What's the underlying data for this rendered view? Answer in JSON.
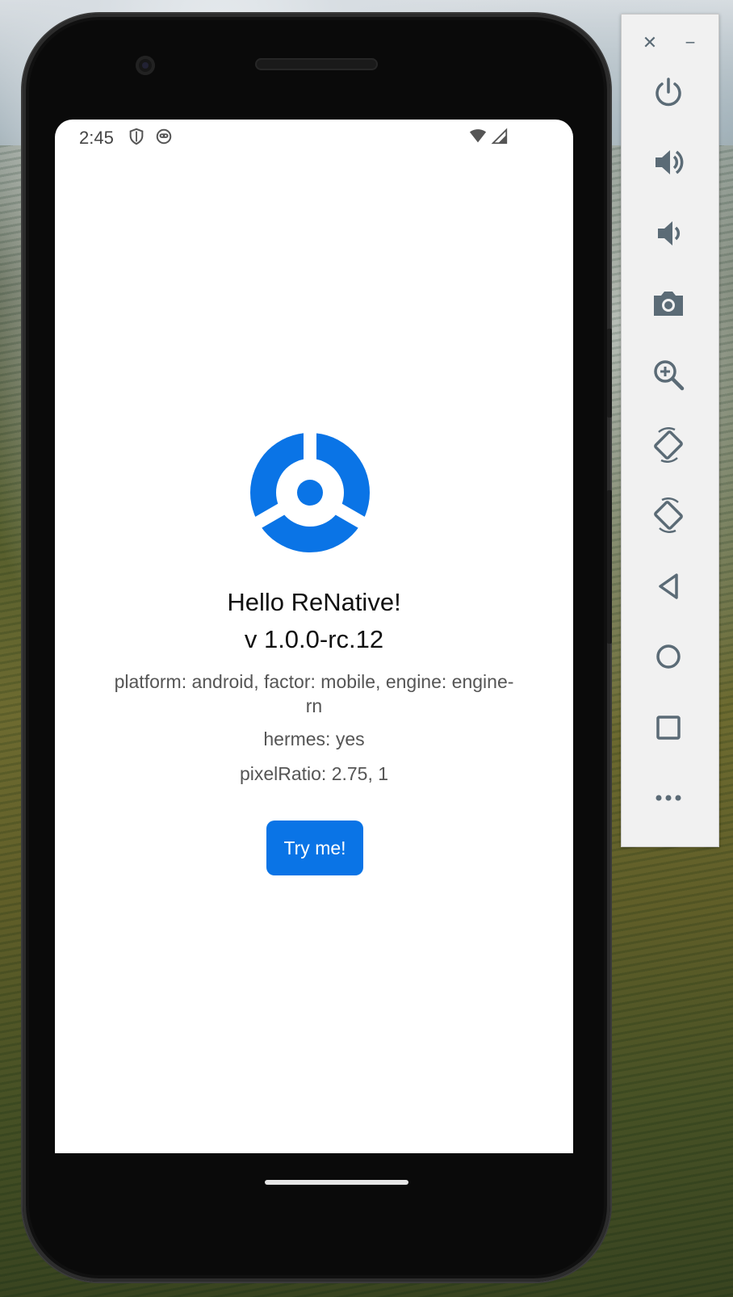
{
  "status_bar": {
    "time": "2:45"
  },
  "app": {
    "greeting": "Hello ReNative!",
    "version": "v 1.0.0-rc.12",
    "platform_info": "platform: android, factor: mobile, engine: engine-rn",
    "hermes": "hermes: yes",
    "pixel_ratio": "pixelRatio: 2.75, 1",
    "try_button_label": "Try me!",
    "accent_color": "#0a74e6"
  },
  "emulator_toolbar": {
    "buttons": [
      "power-icon",
      "volume-up-icon",
      "volume-down-icon",
      "camera-icon",
      "zoom-icon",
      "rotate-left-icon",
      "rotate-right-icon",
      "back-icon",
      "home-icon",
      "overview-icon",
      "more-icon"
    ]
  }
}
